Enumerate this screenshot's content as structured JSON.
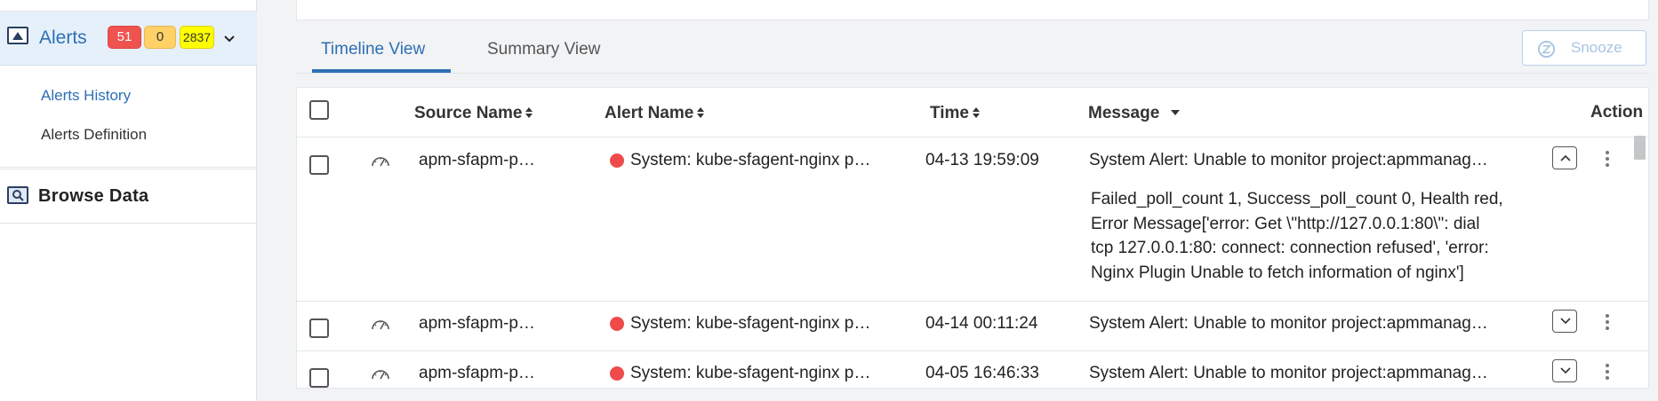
{
  "sidebar": {
    "alerts": {
      "label": "Alerts",
      "icon": "alerts-monitor-icon",
      "badges": {
        "critical": "51",
        "warning": "0",
        "info": "2837"
      },
      "colors": {
        "critical": "#ef5350",
        "warning": "#ffd166",
        "info": "#ffff00"
      }
    },
    "items": [
      {
        "label": "Alerts History",
        "active": true
      },
      {
        "label": "Alerts Definition",
        "active": false
      }
    ],
    "browse": {
      "label": "Browse Data",
      "icon": "browse-data-icon"
    }
  },
  "tabs": [
    {
      "label": "Timeline View",
      "active": true
    },
    {
      "label": "Summary View",
      "active": false
    }
  ],
  "toolbar": {
    "snooze_label": "Snooze",
    "snooze_icon": "snooze-clock-icon"
  },
  "table": {
    "columns": {
      "source": "Source Name",
      "alert": "Alert Name",
      "time": "Time",
      "message": "Message",
      "action": "Action"
    },
    "rows": [
      {
        "source": "apm-sfapm-p…",
        "alert": "System: kube-sfagent-nginx p…",
        "time": "04-13 19:59:09",
        "message": "System Alert: Unable to monitor project:apmmanag…",
        "expanded": true,
        "detail": [
          "Failed_poll_count 1, Success_poll_count 0, Health red,",
          "Error Message['error: Get \\\"http://127.0.0.1:80\\\": dial",
          "tcp 127.0.0.1:80: connect: connection refused', 'error:",
          "Nginx Plugin Unable to fetch information of nginx']"
        ]
      },
      {
        "source": "apm-sfapm-p…",
        "alert": "System: kube-sfagent-nginx p…",
        "time": "04-14 00:11:24",
        "message": "System Alert: Unable to monitor project:apmmanag…",
        "expanded": false
      },
      {
        "source": "apm-sfapm-p…",
        "alert": "System: kube-sfagent-nginx p…",
        "time": "04-05 16:46:33",
        "message": "System Alert: Unable to monitor project:apmmanag…",
        "expanded": false
      }
    ]
  },
  "colors": {
    "accent": "#2d6fb5",
    "status_red": "#f04b4b"
  }
}
